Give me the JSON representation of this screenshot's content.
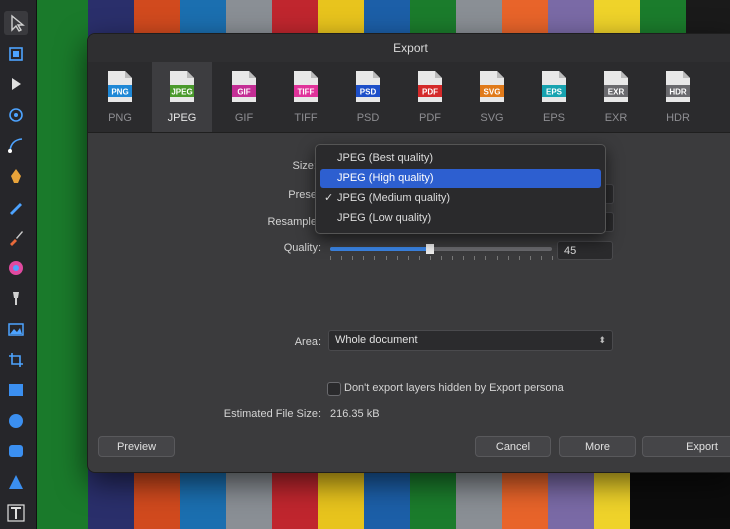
{
  "background": {
    "stripe_colors": [
      "#2a2f6b",
      "#d14a1e",
      "#1b6fb0",
      "#8a8f95",
      "#c0262e",
      "#e8c41d",
      "#1c5fa8",
      "#1b7c2c",
      "#8a8f95",
      "#e8642a",
      "#7a6aa6",
      "#efd32a",
      "#1b7c2c"
    ]
  },
  "toolbar": {
    "tools": [
      {
        "name": "move-tool-icon",
        "color": "#d0d0d0"
      },
      {
        "name": "artboard-tool-icon",
        "color": "#4da3ff"
      },
      {
        "name": "node-tool-icon",
        "color": "#e0e0e0"
      },
      {
        "name": "point-transform-icon",
        "color": "#4da3ff"
      },
      {
        "name": "corner-tool-icon",
        "color": "#4da3ff"
      },
      {
        "name": "pen-tool-icon",
        "color": "#e8a33a"
      },
      {
        "name": "pencil-tool-icon",
        "color": "#4da3ff"
      },
      {
        "name": "brush-tool-icon",
        "color": "#e86a3a"
      },
      {
        "name": "color-picker-icon",
        "color": "#e04aa0"
      },
      {
        "name": "fill-tool-icon",
        "color": "#d0d0d0"
      },
      {
        "name": "place-image-icon",
        "color": "#4da3ff"
      },
      {
        "name": "crop-tool-icon",
        "color": "#4da3ff"
      },
      {
        "name": "rectangle-tool-icon",
        "color": "#3b8ff0"
      },
      {
        "name": "ellipse-tool-icon",
        "color": "#3b8ff0"
      },
      {
        "name": "rounded-rect-tool-icon",
        "color": "#3b8ff0"
      },
      {
        "name": "triangle-tool-icon",
        "color": "#3b8ff0"
      },
      {
        "name": "text-tool-icon",
        "color": "#e0e0e0"
      }
    ]
  },
  "dialog": {
    "title": "Export",
    "formats": [
      {
        "label": "PNG",
        "color": "#1f88d6",
        "selected": false
      },
      {
        "label": "JPEG",
        "color": "#4a9a2c",
        "selected": true
      },
      {
        "label": "GIF",
        "color": "#c42e95",
        "selected": false
      },
      {
        "label": "TIFF",
        "color": "#e0329a",
        "selected": false
      },
      {
        "label": "PSD",
        "color": "#1d4fc9",
        "selected": false
      },
      {
        "label": "PDF",
        "color": "#d42a2a",
        "selected": false
      },
      {
        "label": "SVG",
        "color": "#e07a1a",
        "selected": false
      },
      {
        "label": "EPS",
        "color": "#17a3b0",
        "selected": false
      },
      {
        "label": "EXR",
        "color": "#6a6a6e",
        "selected": false
      },
      {
        "label": "HDR",
        "color": "#6a6a6e",
        "selected": false
      }
    ],
    "size_label": "Size:",
    "preset_label": "Prese",
    "resample_label": "Resample",
    "quality_label": "Quality:",
    "quality_value": "45",
    "quality_fraction": 0.45,
    "area_label": "Area:",
    "area_value": "Whole document",
    "checkbox_label": "Don't export layers hidden by Export persona",
    "file_size_label": "Estimated File Size:",
    "file_size_value": "216.35 kB",
    "buttons": {
      "preview": "Preview",
      "cancel": "Cancel",
      "more": "More",
      "export": "Export"
    }
  },
  "preset_menu": {
    "options": [
      {
        "label": "JPEG (Best quality)",
        "checked": false,
        "highlighted": false
      },
      {
        "label": "JPEG (High quality)",
        "checked": false,
        "highlighted": true
      },
      {
        "label": "JPEG (Medium quality)",
        "checked": true,
        "highlighted": false
      },
      {
        "label": "JPEG (Low quality)",
        "checked": false,
        "highlighted": false
      }
    ],
    "check_glyph": "✓"
  }
}
